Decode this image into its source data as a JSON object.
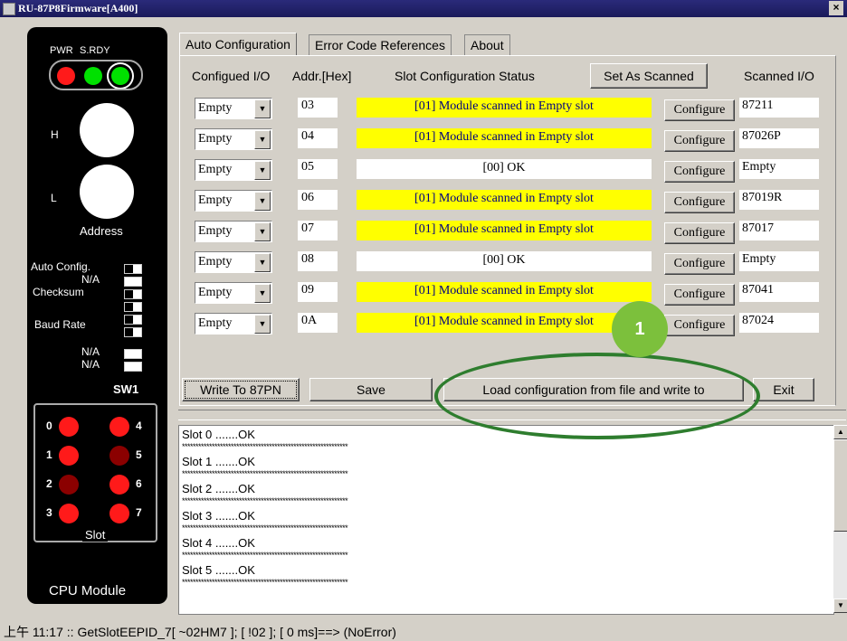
{
  "window": {
    "title": "RU-87P8Firmware[A400]",
    "close_label": "×"
  },
  "device": {
    "pwr_label": "PWR",
    "srdy_label": "S.RDY",
    "h_label": "H",
    "l_label": "L",
    "address_label": "Address",
    "dip_labels": [
      "Auto Config.",
      "N/A",
      "Checksum",
      "Baud Rate",
      "N/A",
      "N/A"
    ],
    "sw_label": "SW1",
    "slot_label": "Slot",
    "slot_numbers": [
      "0",
      "1",
      "2",
      "3",
      "4",
      "5",
      "6",
      "7"
    ],
    "module_label": "CPU Module",
    "colors": {
      "led_red": "#ff1a1a",
      "led_green": "#00e000",
      "led_dark_red": "#8b0000"
    }
  },
  "tabs": [
    {
      "label": "Auto Configuration"
    },
    {
      "label": "Error Code References"
    },
    {
      "label": "About"
    }
  ],
  "headers": {
    "configured": "Configued I/O",
    "addr": "Addr.[Hex]",
    "status": "Slot Configuration Status",
    "set_as_scanned": "Set As Scanned",
    "scanned": "Scanned I/O"
  },
  "rows": [
    {
      "config": "Empty",
      "addr": "03",
      "status": "[01] Module scanned in Empty slot",
      "configure": "Configure",
      "scanned": "87211"
    },
    {
      "config": "Empty",
      "addr": "04",
      "status": "[01] Module scanned in Empty slot",
      "configure": "Configure",
      "scanned": "87026P"
    },
    {
      "config": "Empty",
      "addr": "05",
      "status": "[00] OK",
      "configure": "Configure",
      "scanned": "Empty"
    },
    {
      "config": "Empty",
      "addr": "06",
      "status": "[01] Module scanned in Empty slot",
      "configure": "Configure",
      "scanned": "87019R"
    },
    {
      "config": "Empty",
      "addr": "07",
      "status": "[01] Module scanned in Empty slot",
      "configure": "Configure",
      "scanned": "87017"
    },
    {
      "config": "Empty",
      "addr": "08",
      "status": "[00] OK",
      "configure": "Configure",
      "scanned": "Empty"
    },
    {
      "config": "Empty",
      "addr": "09",
      "status": "[01] Module scanned in Empty slot",
      "configure": "Configure",
      "scanned": "87041"
    },
    {
      "config": "Empty",
      "addr": "0A",
      "status": "[01] Module scanned in Empty slot",
      "configure": "Configure",
      "scanned": "87024"
    }
  ],
  "buttons": {
    "write": "Write To 87PN",
    "save": "Save",
    "load": "Load configuration from file and write to",
    "exit": "Exit"
  },
  "log": {
    "lines": [
      "Slot 0  .......OK",
      "Slot 1  .......OK",
      "Slot 2  .......OK",
      "Slot 3  .......OK",
      "Slot 4  .......OK",
      "Slot 5  .......OK"
    ],
    "separator": "*************************************************************"
  },
  "statusbar": {
    "text": "上午 11:17 :: GetSlotEEPID_7[ ~02HM7 ]; [ !02  ]; [ 0 ms]==> (NoError)"
  },
  "annotation": {
    "badge": "1",
    "color": "#2e7d2e"
  }
}
